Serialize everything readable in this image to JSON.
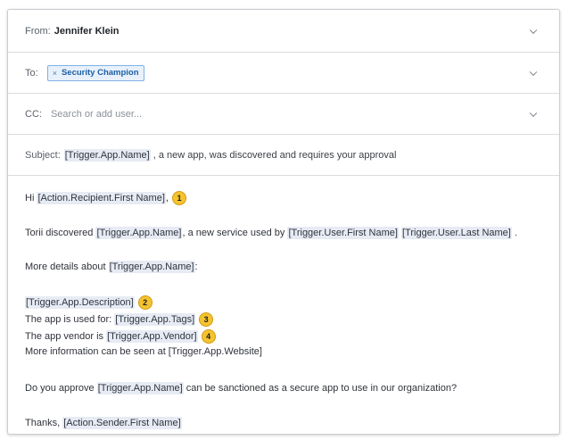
{
  "from": {
    "label": "From:",
    "value": "Jennifer Klein"
  },
  "to": {
    "label": "To:",
    "chip_remove": "×",
    "chip_label": "Security Champion"
  },
  "cc": {
    "label": "CC:",
    "placeholder": "Search or add user..."
  },
  "subject": {
    "label": "Subject:",
    "token": "[Trigger.App.Name]",
    "rest": " , a new app, was discovered and requires your approval"
  },
  "body": {
    "l1_pre": "Hi ",
    "l1_tok": "[Action.Recipient.First Name]",
    "l1_post": ",",
    "l1_badge": "1",
    "l2_pre": "Torii discovered ",
    "l2_tok1": "[Trigger.App.Name]",
    "l2_mid": ", a new service used by ",
    "l2_tok2": "[Trigger.User.First Name]",
    "l2_sp": " ",
    "l2_tok3": "[Trigger.User.Last Name]",
    "l2_post": " .",
    "l3_pre": "More details about ",
    "l3_tok": "[Trigger.App.Name]",
    "l3_post": ":",
    "l4_tok": "[Trigger.App.Description]",
    "l4_badge": "2",
    "l5_pre": "The app is used for: ",
    "l5_tok": "[Trigger.App.Tags]",
    "l5_badge": "3",
    "l6_pre": "The app vendor is ",
    "l6_tok": "[Trigger.App.Vendor]",
    "l6_badge": "4",
    "l7": "More information can be seen at [Trigger.App.Website]",
    "l8_pre": "Do you approve ",
    "l8_tok": "[Trigger.App.Name]",
    "l8_post": " can be sanctioned as a secure app to use in our organization?",
    "l9_pre": "Thanks, ",
    "l9_tok": "[Action.Sender.First Name]"
  }
}
